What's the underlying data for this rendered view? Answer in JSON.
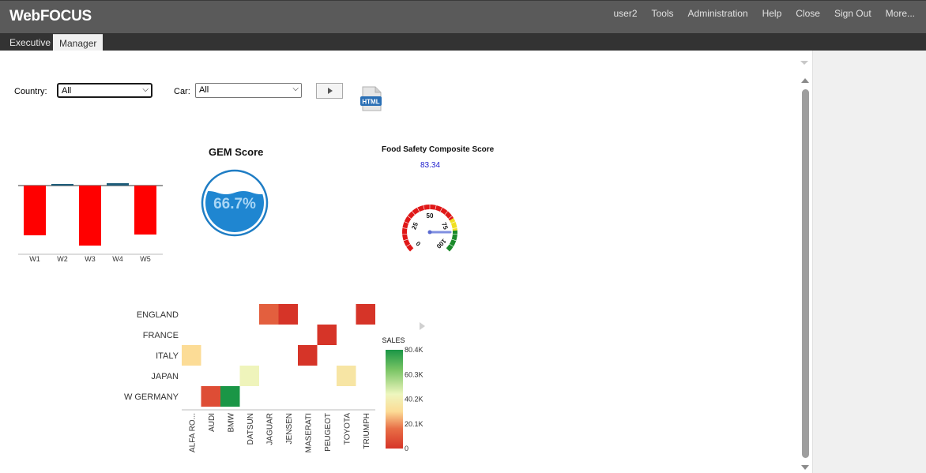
{
  "app": {
    "brand": "WebFOCUS"
  },
  "topnav": [
    "user2",
    "Tools",
    "Administration",
    "Help",
    "Close",
    "Sign Out",
    "More..."
  ],
  "tabs": [
    {
      "label": "Executive",
      "active": false
    },
    {
      "label": "Manager",
      "active": true
    }
  ],
  "filters": {
    "country_label": "Country:",
    "country_value": "All",
    "car_label": "Car:",
    "car_value": "All"
  },
  "html_icon_label": "HTML",
  "bar_chart": {
    "type": "bar",
    "categories": [
      "W1",
      "W2",
      "W3",
      "W4",
      "W5"
    ],
    "values": [
      -63,
      2,
      -76,
      3,
      -62
    ],
    "colors": [
      "#ff0000",
      "#1e5d7a",
      "#ff0000",
      "#1e5d7a",
      "#ff0000"
    ]
  },
  "gem": {
    "title": "GEM Score",
    "value": "66.7%",
    "fraction": 0.667
  },
  "gauge": {
    "title": "Food Safety Composite Score",
    "value_text": "83.34",
    "value": 83.34,
    "ticks": [
      "0",
      "25",
      "50",
      "75",
      "100"
    ],
    "range": [
      0,
      100
    ]
  },
  "chart_data": {
    "type": "heatmap",
    "rows": [
      "ENGLAND",
      "FRANCE",
      "ITALY",
      "JAPAN",
      "W GERMANY"
    ],
    "columns": [
      "ALFA RO...",
      "AUDI",
      "BMW",
      "DATSUN",
      "JAGUAR",
      "JENSEN",
      "MASERATI",
      "PEUGEOT",
      "TOYOTA",
      "TRIUMPH"
    ],
    "cells": [
      {
        "row": "ENGLAND",
        "col": "JAGUAR",
        "value": 12000
      },
      {
        "row": "ENGLAND",
        "col": "JENSEN",
        "value": 0
      },
      {
        "row": "ENGLAND",
        "col": "TRIUMPH",
        "value": 0
      },
      {
        "row": "FRANCE",
        "col": "PEUGEOT",
        "value": 0
      },
      {
        "row": "ITALY",
        "col": "ALFA RO...",
        "value": 30200
      },
      {
        "row": "ITALY",
        "col": "MASERATI",
        "value": 0
      },
      {
        "row": "JAPAN",
        "col": "DATSUN",
        "value": 43000
      },
      {
        "row": "JAPAN",
        "col": "TOYOTA",
        "value": 35000
      },
      {
        "row": "W GERMANY",
        "col": "AUDI",
        "value": 7000
      },
      {
        "row": "W GERMANY",
        "col": "BMW",
        "value": 80400
      }
    ],
    "legend": {
      "title": "SALES",
      "labels": [
        "80.4K",
        "60.3K",
        "40.2K",
        "20.1K",
        "0"
      ],
      "min": 0,
      "max": 80400
    }
  }
}
